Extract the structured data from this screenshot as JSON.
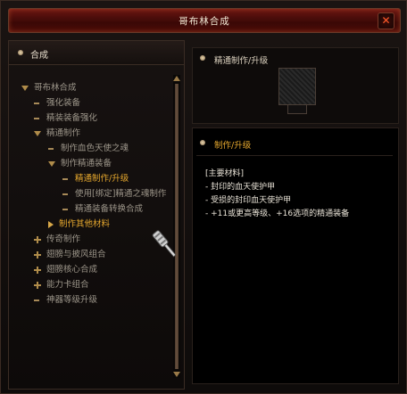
{
  "window": {
    "title": "哥布林合成"
  },
  "left_panel": {
    "header": "合成",
    "tree": [
      {
        "label": "哥布林合成",
        "type": "expanded",
        "level": 0,
        "style": "dim"
      },
      {
        "label": "强化装备",
        "type": "leaf",
        "level": 1,
        "style": "dim"
      },
      {
        "label": "精装装备强化",
        "type": "leaf",
        "level": 1,
        "style": "dim"
      },
      {
        "label": "精通制作",
        "type": "expanded",
        "level": 1,
        "style": "dim"
      },
      {
        "label": "制作血色天使之魂",
        "type": "leaf",
        "level": 2,
        "style": "dim"
      },
      {
        "label": "制作精通装备",
        "type": "expanded",
        "level": 2,
        "style": "dim"
      },
      {
        "label": "精通制作/升级",
        "type": "leaf",
        "level": 3,
        "style": "gold"
      },
      {
        "label": "使用[绑定]精通之魂制作",
        "type": "leaf",
        "level": 3,
        "style": "dim"
      },
      {
        "label": "精通装备转换合成",
        "type": "leaf",
        "level": 3,
        "style": "dim"
      },
      {
        "label": "制作其他材料",
        "type": "arrow",
        "level": 2,
        "style": "gold"
      },
      {
        "label": "传奇制作",
        "type": "collapsed",
        "level": 1,
        "style": "dim"
      },
      {
        "label": "翅膀与披风组合",
        "type": "collapsed",
        "level": 1,
        "style": "dim"
      },
      {
        "label": "翅膀核心合成",
        "type": "collapsed",
        "level": 1,
        "style": "dim"
      },
      {
        "label": "能力卡组合",
        "type": "collapsed",
        "level": 1,
        "style": "dim"
      },
      {
        "label": "神器等级升级",
        "type": "leaf",
        "level": 1,
        "style": "dim"
      }
    ]
  },
  "right_top": {
    "label": "精通制作/升级"
  },
  "detail": {
    "title": "制作/升级",
    "lines": [
      "[主要材料]",
      "- 封印的血天使护甲",
      "- 受损的封印血天使护甲",
      "- +11或更高等级、+16选项的精通装备"
    ]
  },
  "colors": {
    "accent_gold": "#e6a82e",
    "title_red": "#6b1612",
    "close_orange": "#ff5a2a"
  },
  "icons": [
    "close-icon",
    "hammer-cursor-icon",
    "armor-item-icon"
  ]
}
